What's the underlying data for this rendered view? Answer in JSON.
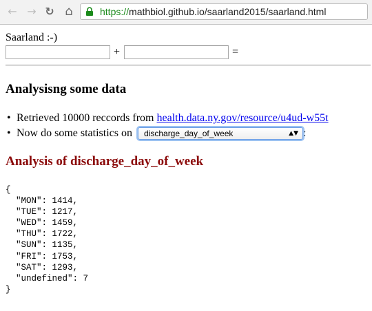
{
  "browser": {
    "back_glyph": "←",
    "forward_glyph": "→",
    "reload_glyph": "↻",
    "home_glyph": "⌂",
    "url_scheme": "https://",
    "url_rest": "mathbiol.github.io/saarland2015/saarland.html"
  },
  "page": {
    "greeting": "Saarland :-)",
    "plus": "+",
    "equals": "=",
    "input_a_value": "",
    "input_b_value": "",
    "section_title": "Analysisng some data",
    "retrieved_prefix": "Retrieved 10000 reccords from ",
    "retrieved_link": "health.data.ny.gov/resource/u4ud-w55t",
    "stats_prefix": "Now do some statistics on ",
    "stats_select_value": "discharge_day_of_week",
    "stats_suffix": ":",
    "analysis_title": "Analysis of discharge_day_of_week",
    "json_text": "{\n  \"MON\": 1414,\n  \"TUE\": 1217,\n  \"WED\": 1459,\n  \"THU\": 1722,\n  \"SUN\": 1135,\n  \"FRI\": 1753,\n  \"SAT\": 1293,\n  \"undefined\": 7\n}"
  },
  "colors": {
    "analysis_title": "#8b0a0a",
    "link": "#0000ee",
    "url_scheme": "#1a8a1a"
  }
}
